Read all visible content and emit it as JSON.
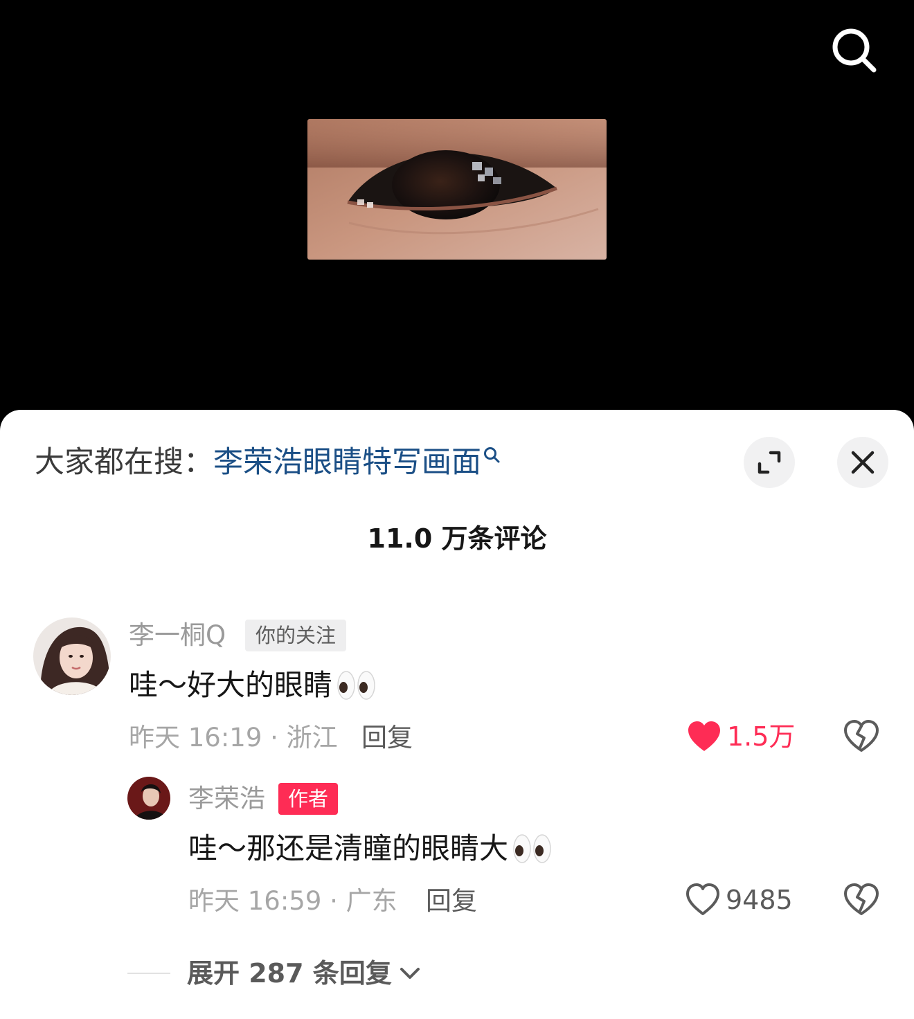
{
  "search_hint": {
    "prefix": "大家都在搜：",
    "keyword": "李荣浩眼睛特写画面"
  },
  "comments_header": {
    "count_label": "11.0 万条评论"
  },
  "comments": [
    {
      "author": "李一桐Q",
      "badge": "你的关注",
      "text": "哇～好大的眼睛",
      "emoji": "eyes",
      "time_location": "昨天 16:19 · 浙江",
      "reply_label": "回复",
      "likes": "1.5万",
      "liked": true
    },
    {
      "author": "李荣浩",
      "badge": "作者",
      "text": "哇～那还是清瞳的眼睛大",
      "emoji": "eyes",
      "time_location": "昨天 16:59 · 广东",
      "reply_label": "回复",
      "likes": "9485",
      "liked": false
    }
  ],
  "expand_replies": {
    "label": "展开 287 条回复"
  },
  "colors": {
    "link": "#1b4f86",
    "like_active": "#fe2c55",
    "author_badge": "#fe2c55"
  },
  "icons": [
    "search-icon",
    "expand-icon",
    "close-icon",
    "heart-icon",
    "dislike-icon",
    "chevron-down-icon"
  ]
}
